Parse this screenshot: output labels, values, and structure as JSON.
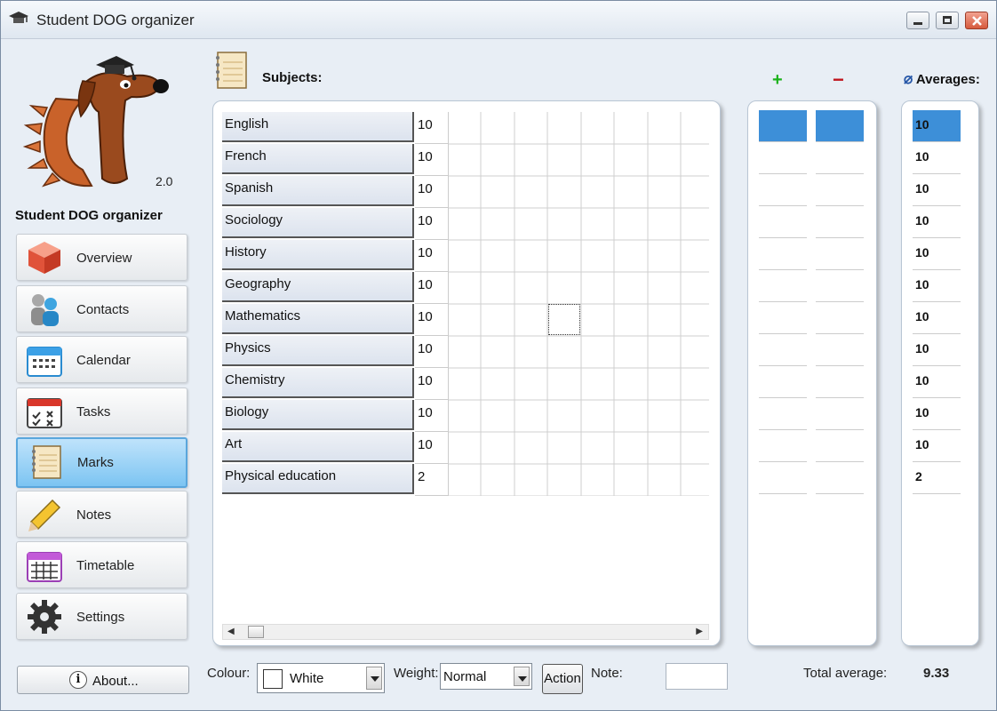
{
  "window": {
    "title": "Student DOG organizer",
    "buttons": [
      "minimize-icon",
      "maximize-icon",
      "close-icon"
    ]
  },
  "sidebar": {
    "version": "2.0",
    "app_name": "Student DOG organizer",
    "items": [
      {
        "label": "Overview",
        "icon": "cube-icon"
      },
      {
        "label": "Contacts",
        "icon": "people-icon"
      },
      {
        "label": "Calendar",
        "icon": "calendar-icon"
      },
      {
        "label": "Tasks",
        "icon": "tasks-checklist-icon"
      },
      {
        "label": "Marks",
        "icon": "notebook-icon",
        "active": true
      },
      {
        "label": "Notes",
        "icon": "pencil-icon"
      },
      {
        "label": "Timetable",
        "icon": "timetable-icon"
      },
      {
        "label": "Settings",
        "icon": "gear-icon"
      }
    ],
    "about_label": "About..."
  },
  "subjects": {
    "title": "Subjects:",
    "rows": [
      {
        "name": "English",
        "mark": "10"
      },
      {
        "name": "French",
        "mark": "10"
      },
      {
        "name": "Spanish",
        "mark": "10"
      },
      {
        "name": "Sociology",
        "mark": "10"
      },
      {
        "name": "History",
        "mark": "10"
      },
      {
        "name": "Geography",
        "mark": "10"
      },
      {
        "name": "Mathematics",
        "mark": "10"
      },
      {
        "name": "Physics",
        "mark": "10"
      },
      {
        "name": "Chemistry",
        "mark": "10"
      },
      {
        "name": "Biology",
        "mark": "10"
      },
      {
        "name": "Art",
        "mark": "10"
      },
      {
        "name": "Physical education",
        "mark": "2"
      }
    ]
  },
  "plus_minus": {
    "plus": "+",
    "minus": "−"
  },
  "averages": {
    "symbol": "⌀",
    "title": "Averages:",
    "values": [
      "10",
      "10",
      "10",
      "10",
      "10",
      "10",
      "10",
      "10",
      "10",
      "10",
      "10",
      "2"
    ]
  },
  "toolbar": {
    "colour_label": "Colour:",
    "colour_value": "White",
    "weight_label": "Weight:",
    "weight_value": "Normal",
    "action_label": "Action",
    "note_label": "Note:",
    "note_value": "",
    "total_label": "Total average:",
    "total_value": "9.33"
  },
  "colors": {
    "selection": "#3d8fd8",
    "active_nav": "#7cc4f2",
    "plus": "#1bb21b",
    "minus": "#c0141c"
  }
}
